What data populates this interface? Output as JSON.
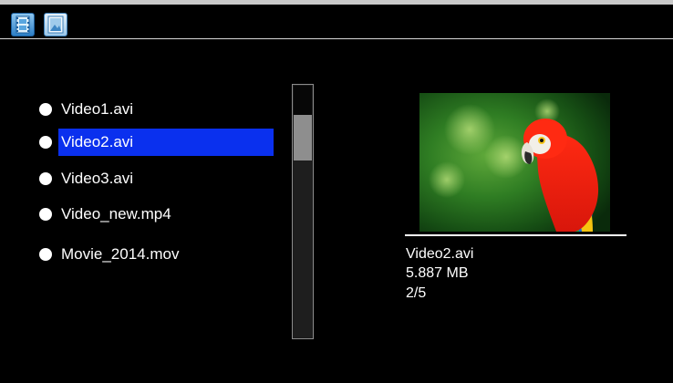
{
  "toolbar": {
    "video_tab_icon": "film-strip-icon",
    "photo_tab_icon": "picture-icon"
  },
  "files": [
    {
      "name": "Video1.avi",
      "selected": false
    },
    {
      "name": "Video2.avi",
      "selected": true
    },
    {
      "name": "Video3.avi",
      "selected": false
    },
    {
      "name": "Video_new.mp4",
      "selected": false
    },
    {
      "name": "Movie_2014.mov",
      "selected": false
    }
  ],
  "preview": {
    "thumbnail": "parrot-thumbnail",
    "filename": "Video2.avi",
    "size": "5.887 MB",
    "position": "2/5"
  },
  "colors": {
    "background": "#000000",
    "selection": "#0a30ee",
    "text": "#ffffff"
  }
}
